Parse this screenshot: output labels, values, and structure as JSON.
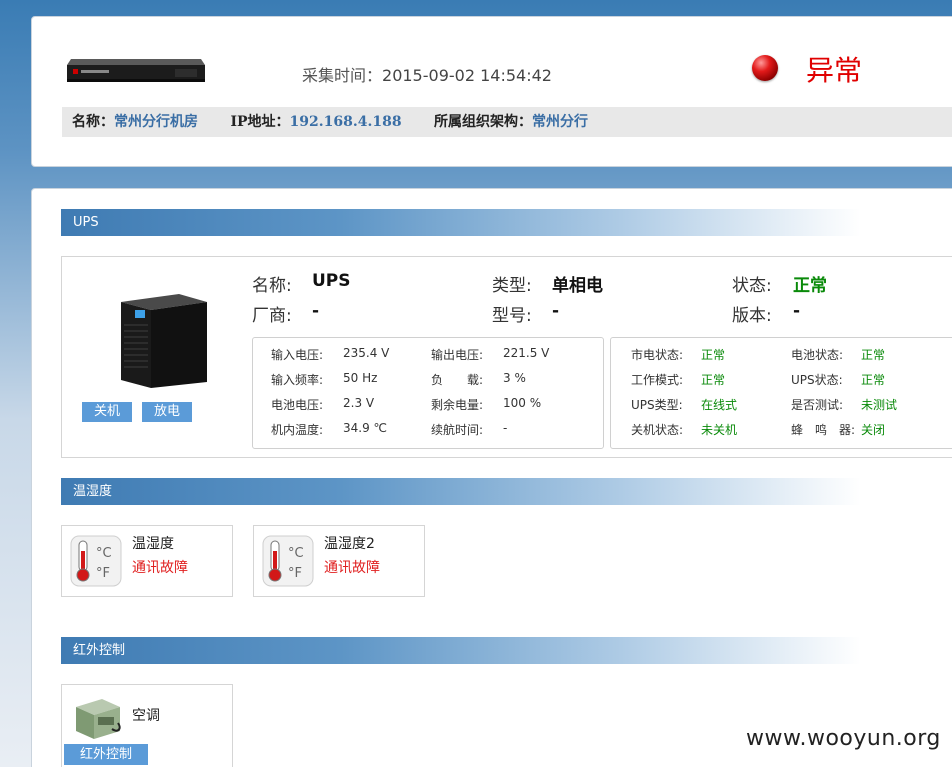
{
  "header": {
    "collect_label": "采集时间：",
    "collect_time": "2015-09-02 14:54:42",
    "status_text": "异常",
    "name_label": "名称",
    "name_value": "常州分行机房",
    "ip_label": "IP地址",
    "ip_value": "192.168.4.188",
    "org_label": "所属组织架构",
    "org_value": "常州分行",
    "colon": "："
  },
  "ups": {
    "section_title": "UPS",
    "name_label": "名称:",
    "name_value": "UPS",
    "type_label": "类型:",
    "type_value": "单相电",
    "status_label": "状态:",
    "status_value": "正常",
    "vendor_label": "厂商:",
    "vendor_value": "-",
    "model_label": "型号:",
    "model_value": "-",
    "version_label": "版本:",
    "version_value": "-",
    "btn_shutdown": "关机",
    "btn_discharge": "放电",
    "metrics": [
      {
        "label": "输入电压:",
        "value": "235.4 V"
      },
      {
        "label": "输出电压:",
        "value": "221.5 V"
      },
      {
        "label": "输入频率:",
        "value": "50 Hz"
      },
      {
        "label": "负　　载:",
        "value": "3 %"
      },
      {
        "label": "电池电压:",
        "value": "2.3 V"
      },
      {
        "label": "剩余电量:",
        "value": "100 %"
      },
      {
        "label": "机内温度:",
        "value": "34.9 ℃"
      },
      {
        "label": "续航时间:",
        "value": "-"
      }
    ],
    "states": [
      {
        "label": "市电状态:",
        "value": "正常"
      },
      {
        "label": "电池状态:",
        "value": "正常"
      },
      {
        "label": "工作模式:",
        "value": "正常"
      },
      {
        "label": "UPS状态:",
        "value": "正常"
      },
      {
        "label": "UPS类型:",
        "value": "在线式"
      },
      {
        "label": "是否测试:",
        "value": "未测试"
      },
      {
        "label": "关机状态:",
        "value": "未关机"
      },
      {
        "label": "蜂　鸣　器:",
        "value": "关闭"
      }
    ]
  },
  "temp": {
    "section_title": "温湿度",
    "sensors": [
      {
        "name": "温湿度",
        "status": "通讯故障"
      },
      {
        "name": "温湿度2",
        "status": "通讯故障"
      }
    ]
  },
  "ir": {
    "section_title": "红外控制",
    "device_name": "空调",
    "button_label": "红外控制"
  },
  "watermark": "www.wooyun.org",
  "colors": {
    "alarm": "#e00000",
    "ok": "#0a8a0a",
    "button": "#5b9bd8",
    "link": "#3a6ea5"
  }
}
